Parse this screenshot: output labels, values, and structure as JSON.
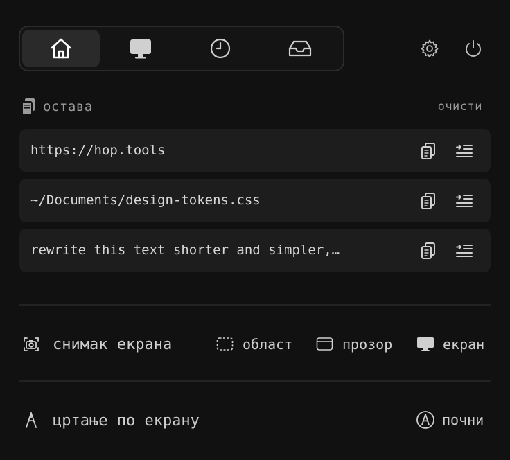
{
  "tabs": [
    {
      "id": "home",
      "icon": "home-icon",
      "active": true
    },
    {
      "id": "display",
      "icon": "monitor-icon",
      "active": false
    },
    {
      "id": "history",
      "icon": "clock-icon",
      "active": false
    },
    {
      "id": "inbox",
      "icon": "inbox-tray-icon",
      "active": false
    }
  ],
  "top_actions": {
    "settings_icon": "gear-icon",
    "power_icon": "power-icon"
  },
  "clipboard": {
    "icon": "clipboard-icon",
    "label": "остава",
    "clear_label": "очисти",
    "items": [
      {
        "text": "https://hop.tools"
      },
      {
        "text": "~/Documents/design-tokens.css"
      },
      {
        "text": "rewrite this text shorter and simpler,…"
      }
    ]
  },
  "screenshot": {
    "icon": "camera-icon",
    "label": "снимак екрана",
    "options": [
      {
        "icon": "dashed-region-icon",
        "label": "област"
      },
      {
        "icon": "window-icon",
        "label": "прозор"
      },
      {
        "icon": "monitor-icon",
        "label": "екран"
      }
    ]
  },
  "draw": {
    "icon": "pen-nib-icon",
    "label": "цртање по екрану",
    "start_icon": "pen-circle-icon",
    "start_label": "почни"
  },
  "colors": {
    "background": "#111111",
    "item_bg": "#1d1d1d",
    "text": "#d6d6d6",
    "muted": "#9a9a9a"
  }
}
